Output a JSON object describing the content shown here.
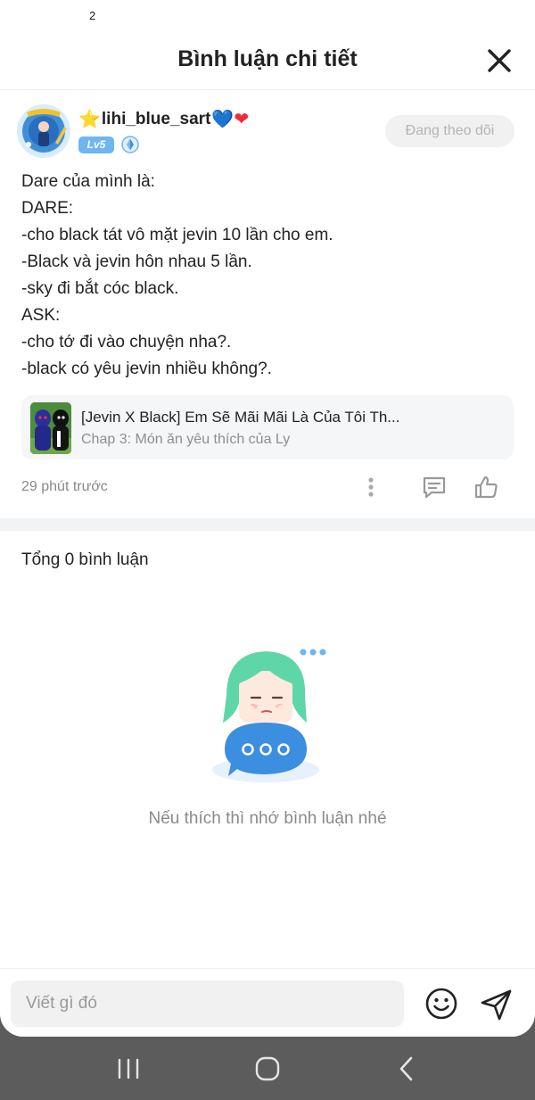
{
  "status_bar": {
    "number": "2"
  },
  "header": {
    "title": "Bình luận chi tiết",
    "close_icon": "close-icon"
  },
  "comment": {
    "username": "lihi_blue_sart",
    "username_prefix_emoji": "⭐",
    "username_suffix_emoji_1": "💙",
    "username_suffix_emoji_2": "❤",
    "level_badge": "Lv5",
    "follow_button": "Đang theo dõi",
    "body_lines": [
      "Dare của mình là:",
      "DARE:",
      "-cho black tát vô mặt jevin 10 lần cho em.",
      "-Black và jevin hôn nhau 5 lần.",
      "-sky đi bắt cóc black.",
      "ASK:",
      "-cho tớ đi vào chuyện nha?.",
      "-black có yêu jevin nhiều không?."
    ],
    "story_card": {
      "title": "[Jevin X Black] Em Sẽ Mãi Mãi Là Của Tôi Th...",
      "chapter": "Chap 3: Món ăn yêu thích của Ly"
    },
    "timestamp": "29 phút trước"
  },
  "replies": {
    "total_label": "Tổng 0 bình luận",
    "empty_message": "Nếu thích thì nhớ bình luận nhé"
  },
  "input_bar": {
    "placeholder": "Viết gì đó"
  },
  "colors": {
    "accent_blue": "#6eb5f1",
    "follow_bg": "#f1f1f1",
    "muted_text": "#8a8a8a",
    "nav_bar_bg": "#5c5c5c"
  }
}
